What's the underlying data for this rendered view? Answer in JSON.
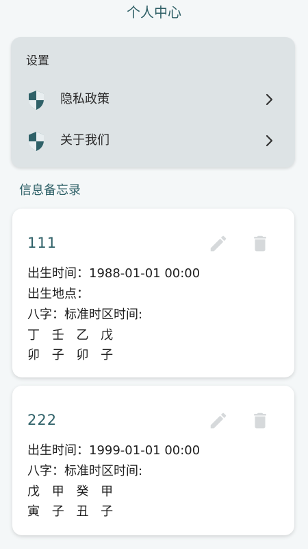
{
  "header": {
    "title": "个人中心"
  },
  "settings": {
    "heading": "设置",
    "items": [
      {
        "label": "隐私政策",
        "icon": "shield-icon"
      },
      {
        "label": "关于我们",
        "icon": "shield-icon"
      }
    ]
  },
  "memo_section": {
    "title": "信息备忘录"
  },
  "memos": [
    {
      "name": "111",
      "birth_time": "出生时间：1988-01-01 00:00",
      "birth_place": "出生地点：",
      "bazi_label": "八字：标准时区时间:",
      "pillars_top": "丁 壬 乙 戊",
      "pillars_bottom": "卯 子 卯 子"
    },
    {
      "name": "222",
      "birth_time": "出生时间：1999-01-01 00:00",
      "bazi_label": "八字：标准时区时间:",
      "pillars_top": "戊 甲 癸 甲",
      "pillars_bottom": "寅 子 丑 子"
    }
  ],
  "colors": {
    "accent": "#2f6168",
    "background": "#f4f7f8",
    "settings_card": "#dde3e5",
    "icon_disabled": "#d6d9db"
  }
}
